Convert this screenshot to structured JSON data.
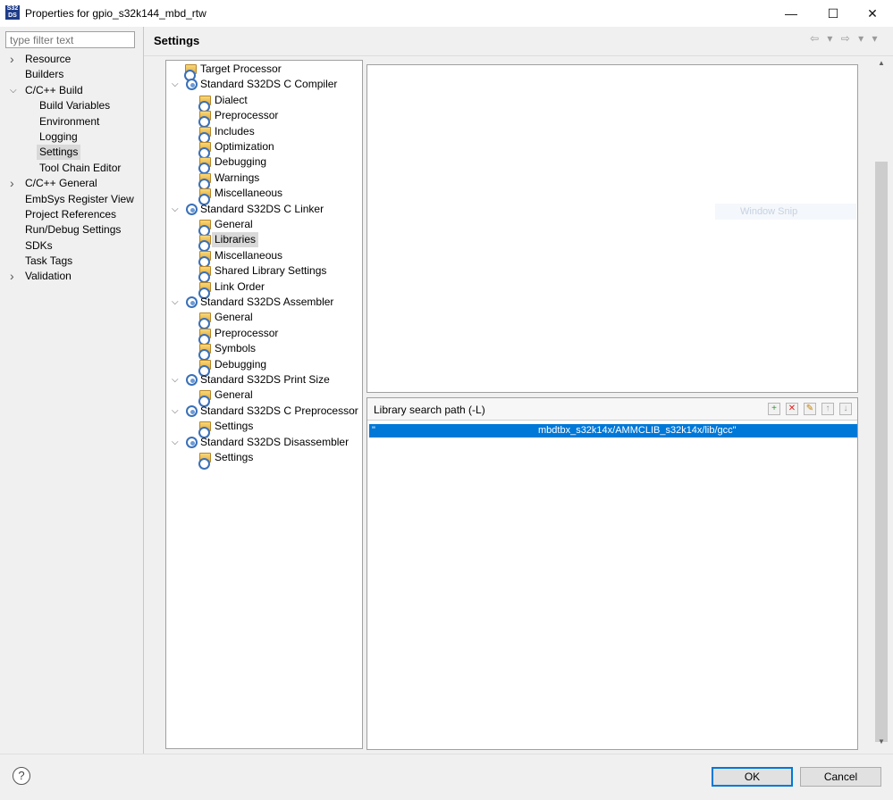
{
  "window": {
    "app_icon_text": "S32 DS",
    "title": "Properties for gpio_s32k144_mbd_rtw",
    "minimize": "—",
    "maximize": "☐",
    "close": "✕"
  },
  "filter": {
    "placeholder": "type filter text"
  },
  "nav": {
    "items": [
      {
        "label": "Resource",
        "expandable": true,
        "level": 0
      },
      {
        "label": "Builders",
        "expandable": false,
        "level": 0
      },
      {
        "label": "C/C++ Build",
        "expandable": true,
        "expanded": true,
        "level": 0
      },
      {
        "label": "Build Variables",
        "level": 1
      },
      {
        "label": "Environment",
        "level": 1
      },
      {
        "label": "Logging",
        "level": 1
      },
      {
        "label": "Settings",
        "level": 1,
        "selected": true
      },
      {
        "label": "Tool Chain Editor",
        "level": 1
      },
      {
        "label": "C/C++ General",
        "expandable": true,
        "level": 0
      },
      {
        "label": "EmbSys Register View",
        "level": 0
      },
      {
        "label": "Project References",
        "level": 0
      },
      {
        "label": "Run/Debug Settings",
        "level": 0
      },
      {
        "label": "SDKs",
        "level": 0
      },
      {
        "label": "Task Tags",
        "level": 0
      },
      {
        "label": "Validation",
        "expandable": true,
        "level": 0
      }
    ]
  },
  "settings": {
    "title": "Settings",
    "history_buttons": "⇦ ▾ ⇨ ▾ ▾"
  },
  "tool_tree": {
    "items": [
      {
        "label": "Target Processor",
        "kind": "option",
        "level": 1
      },
      {
        "label": "Standard S32DS C Compiler",
        "kind": "tool",
        "level": 0
      },
      {
        "label": "Dialect",
        "kind": "option",
        "level": 2
      },
      {
        "label": "Preprocessor",
        "kind": "option",
        "level": 2
      },
      {
        "label": "Includes",
        "kind": "option",
        "level": 2
      },
      {
        "label": "Optimization",
        "kind": "option",
        "level": 2
      },
      {
        "label": "Debugging",
        "kind": "option",
        "level": 2
      },
      {
        "label": "Warnings",
        "kind": "option",
        "level": 2
      },
      {
        "label": "Miscellaneous",
        "kind": "option",
        "level": 2
      },
      {
        "label": "Standard S32DS C Linker",
        "kind": "tool",
        "level": 0
      },
      {
        "label": "General",
        "kind": "option",
        "level": 2
      },
      {
        "label": "Libraries",
        "kind": "option",
        "level": 2,
        "selected": true
      },
      {
        "label": "Miscellaneous",
        "kind": "option",
        "level": 2
      },
      {
        "label": "Shared Library Settings",
        "kind": "option",
        "level": 2
      },
      {
        "label": "Link Order",
        "kind": "option",
        "level": 2
      },
      {
        "label": "Standard S32DS Assembler",
        "kind": "tool",
        "level": 0
      },
      {
        "label": "General",
        "kind": "option",
        "level": 2
      },
      {
        "label": "Preprocessor",
        "kind": "option",
        "level": 2
      },
      {
        "label": "Symbols",
        "kind": "option",
        "level": 2
      },
      {
        "label": "Debugging",
        "kind": "option",
        "level": 2
      },
      {
        "label": "Standard S32DS Print Size",
        "kind": "tool",
        "level": 0
      },
      {
        "label": "General",
        "kind": "option",
        "level": 2
      },
      {
        "label": "Standard S32DS C Preprocessor",
        "kind": "tool",
        "level": 0
      },
      {
        "label": "Settings",
        "kind": "option",
        "level": 2
      },
      {
        "label": "Standard S32DS Disassembler",
        "kind": "tool",
        "level": 0
      },
      {
        "label": "Settings",
        "kind": "option",
        "level": 2
      }
    ]
  },
  "ghost_tooltip": "Window Snip",
  "library_search": {
    "title": "Library search path (-L)",
    "tools": [
      "+",
      "✕",
      "✎",
      "↑",
      "↓"
    ],
    "row_quote": "\"",
    "row_path": "mbdtbx_s32k14x/AMMCLIB_s32k14x/lib/gcc\""
  },
  "footer": {
    "help": "?",
    "ok": "OK",
    "cancel": "Cancel"
  },
  "colors": {
    "selection": "#0078d7",
    "tool_icon": "#3a70b8",
    "option_icon": "#e4a83a"
  }
}
